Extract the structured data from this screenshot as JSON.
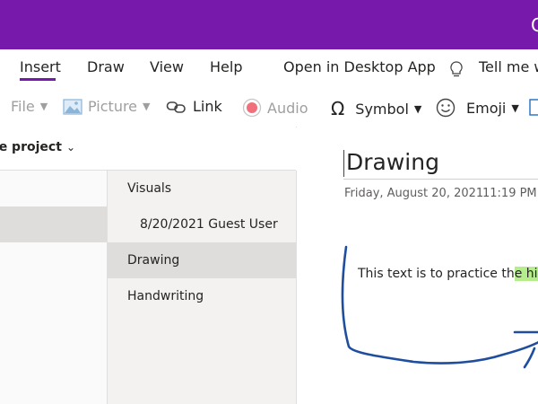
{
  "titlebar": {
    "right_glyph": "C"
  },
  "ribbon": {
    "tabs": [
      {
        "label": "Insert",
        "active": true
      },
      {
        "label": "Draw"
      },
      {
        "label": "View"
      },
      {
        "label": "Help"
      },
      {
        "label": "Open in Desktop App"
      }
    ],
    "tell_me": "Tell me wh",
    "accent_color": "#7719aa"
  },
  "toolbar": {
    "file": "File",
    "picture": "Picture",
    "link": "Link",
    "audio": "Audio",
    "symbol": "Symbol",
    "emoji": "Emoji"
  },
  "notebook": {
    "title": "te project"
  },
  "pages": [
    {
      "label": "Visuals",
      "indent": 0
    },
    {
      "label": "8/20/2021 Guest User",
      "indent": 1
    },
    {
      "label": "Drawing",
      "indent": 0,
      "selected": true
    },
    {
      "label": "Handwriting",
      "indent": 0
    }
  ],
  "page": {
    "title": "Drawing",
    "date": "Friday, August 20, 2021",
    "time": "11:19 PM",
    "text_before": "This text is to practice th",
    "text_highlight": "e high",
    "highlight_color": "#b5ec8c",
    "ink_color": "#1f4e9e"
  }
}
